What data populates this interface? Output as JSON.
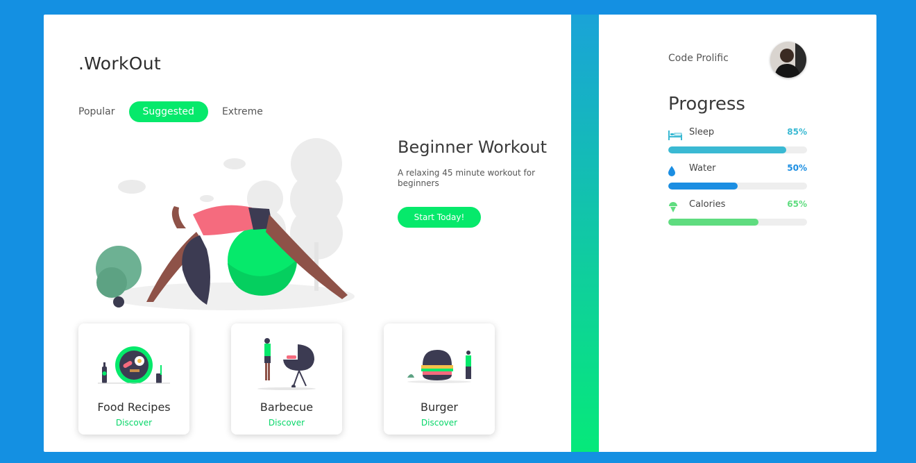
{
  "app": {
    "logo": ".WorkOut"
  },
  "tabs": [
    {
      "label": "Popular",
      "active": false
    },
    {
      "label": "Suggested",
      "active": true
    },
    {
      "label": "Extreme",
      "active": false
    }
  ],
  "hero": {
    "title": "Beginner Workout",
    "description": "A relaxing 45 minute workout for beginners",
    "button": "Start Today!"
  },
  "recipes": [
    {
      "name": "Food Recipes",
      "link": "Discover"
    },
    {
      "name": "Barbecue",
      "link": "Discover"
    },
    {
      "name": "Burger",
      "link": "Discover"
    }
  ],
  "user": {
    "name": "Code Prolific"
  },
  "progress": {
    "title": "Progress",
    "metrics": [
      {
        "label": "Sleep",
        "percent_text": "85%",
        "value": 85,
        "color": "#3ab9d3",
        "icon": "bed-icon"
      },
      {
        "label": "Water",
        "percent_text": "50%",
        "value": 50,
        "color": "#1b8ee2",
        "icon": "water-drop-icon"
      },
      {
        "label": "Calories",
        "percent_text": "65%",
        "value": 65,
        "color": "#5fdc7f",
        "icon": "ice-cream-icon"
      }
    ]
  },
  "colors": {
    "background": "#1490e2",
    "accent": "#06e96b",
    "panel_gradient_top": "#1aa3d8",
    "panel_gradient_bottom": "#06e97a"
  }
}
